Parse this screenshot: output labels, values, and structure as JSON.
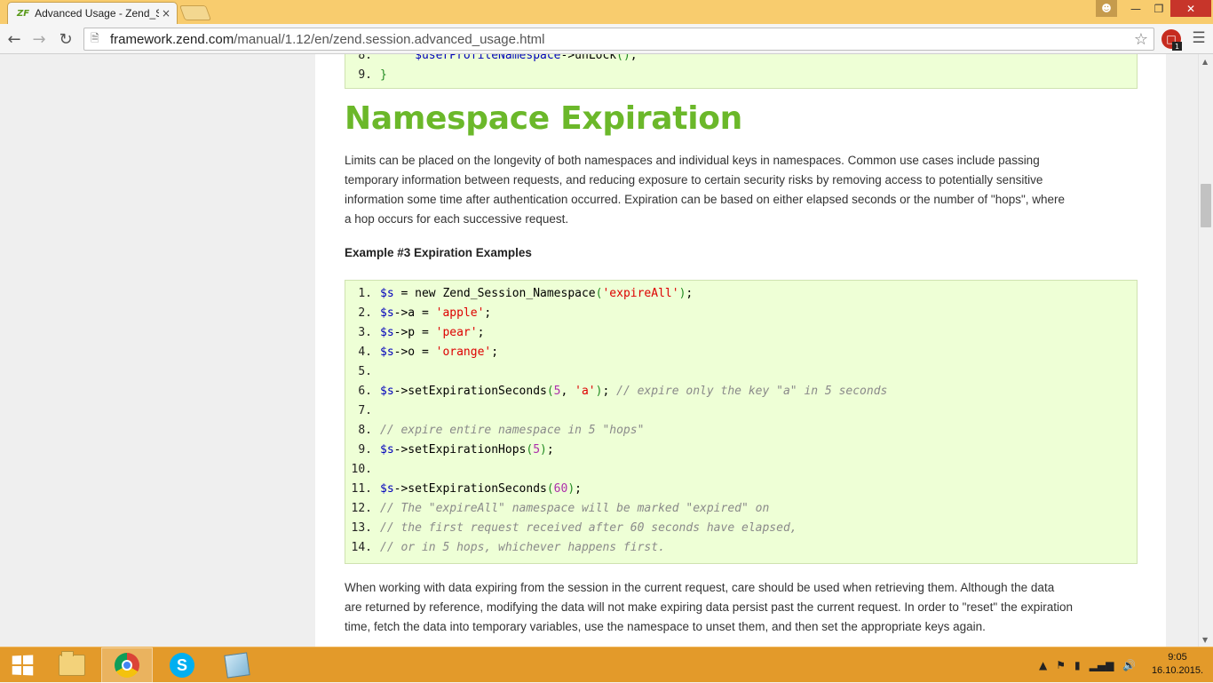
{
  "browser": {
    "tab_title": "Advanced Usage - Zend_S",
    "tab_logo": "ZF",
    "tab_close": "×",
    "url_host": "framework.zend.com",
    "url_path": "/manual/1.12/en/zend.session.advanced_usage.html",
    "ext_badge": "1",
    "colors": {
      "titlebar": "#f8cc6e",
      "close": "#c7352a"
    }
  },
  "page": {
    "top_code": [
      {
        "num": "8.",
        "parts": [
          {
            "cls": "d",
            "text": "     "
          },
          {
            "cls": "v",
            "text": "$userProfileNamespace"
          },
          {
            "cls": "d",
            "text": "->unLock"
          },
          {
            "cls": "p",
            "text": "()"
          },
          {
            "cls": "d",
            "text": ";"
          }
        ]
      },
      {
        "num": "9.",
        "parts": [
          {
            "cls": "p",
            "text": "}"
          }
        ]
      }
    ],
    "heading": "Namespace Expiration",
    "intro_lines": [
      "Limits can be placed on the longevity of both namespaces and individual keys in namespaces. Common use cases include passing",
      "temporary information between requests, and reducing exposure to certain security risks by removing access to potentially sensitive",
      "information some time after authentication occurred. Expiration can be based on either elapsed seconds or the number of \"hops\", where",
      "a hop occurs for each successive request."
    ],
    "example_title": "Example #3 Expiration Examples",
    "code": [
      {
        "num": "1.",
        "parts": [
          {
            "cls": "v",
            "text": "$s"
          },
          {
            "cls": "d",
            "text": " = "
          },
          {
            "cls": "k",
            "text": "new"
          },
          {
            "cls": "d",
            "text": " Zend_Session_Namespace"
          },
          {
            "cls": "p",
            "text": "("
          },
          {
            "cls": "s",
            "text": "'expireAll'"
          },
          {
            "cls": "p",
            "text": ")"
          },
          {
            "cls": "d",
            "text": ";"
          }
        ]
      },
      {
        "num": "2.",
        "parts": [
          {
            "cls": "v",
            "text": "$s"
          },
          {
            "cls": "d",
            "text": "->a = "
          },
          {
            "cls": "s",
            "text": "'apple'"
          },
          {
            "cls": "d",
            "text": ";"
          }
        ]
      },
      {
        "num": "3.",
        "parts": [
          {
            "cls": "v",
            "text": "$s"
          },
          {
            "cls": "d",
            "text": "->p = "
          },
          {
            "cls": "s",
            "text": "'pear'"
          },
          {
            "cls": "d",
            "text": ";"
          }
        ]
      },
      {
        "num": "4.",
        "parts": [
          {
            "cls": "v",
            "text": "$s"
          },
          {
            "cls": "d",
            "text": "->o = "
          },
          {
            "cls": "s",
            "text": "'orange'"
          },
          {
            "cls": "d",
            "text": ";"
          }
        ]
      },
      {
        "num": "5.",
        "parts": []
      },
      {
        "num": "6.",
        "parts": [
          {
            "cls": "v",
            "text": "$s"
          },
          {
            "cls": "d",
            "text": "->setExpirationSeconds"
          },
          {
            "cls": "p",
            "text": "("
          },
          {
            "cls": "n",
            "text": "5"
          },
          {
            "cls": "d",
            "text": ", "
          },
          {
            "cls": "s",
            "text": "'a'"
          },
          {
            "cls": "p",
            "text": ")"
          },
          {
            "cls": "d",
            "text": "; "
          },
          {
            "cls": "c",
            "text": "// expire only the key \"a\" in 5 seconds"
          }
        ]
      },
      {
        "num": "7.",
        "parts": []
      },
      {
        "num": "8.",
        "parts": [
          {
            "cls": "c",
            "text": "// expire entire namespace in 5 \"hops\""
          }
        ]
      },
      {
        "num": "9.",
        "parts": [
          {
            "cls": "v",
            "text": "$s"
          },
          {
            "cls": "d",
            "text": "->setExpirationHops"
          },
          {
            "cls": "p",
            "text": "("
          },
          {
            "cls": "n",
            "text": "5"
          },
          {
            "cls": "p",
            "text": ")"
          },
          {
            "cls": "d",
            "text": ";"
          }
        ]
      },
      {
        "num": "10.",
        "parts": []
      },
      {
        "num": "11.",
        "parts": [
          {
            "cls": "v",
            "text": "$s"
          },
          {
            "cls": "d",
            "text": "->setExpirationSeconds"
          },
          {
            "cls": "p",
            "text": "("
          },
          {
            "cls": "n",
            "text": "60"
          },
          {
            "cls": "p",
            "text": ")"
          },
          {
            "cls": "d",
            "text": ";"
          }
        ]
      },
      {
        "num": "12.",
        "parts": [
          {
            "cls": "c",
            "text": "// The \"expireAll\" namespace will be marked \"expired\" on"
          }
        ]
      },
      {
        "num": "13.",
        "parts": [
          {
            "cls": "c",
            "text": "// the first request received after 60 seconds have elapsed,"
          }
        ]
      },
      {
        "num": "14.",
        "parts": [
          {
            "cls": "c",
            "text": "// or in 5 hops, whichever happens first."
          }
        ]
      }
    ],
    "outro_lines": [
      "When working with data expiring from the session in the current request, care should be used when retrieving them. Although the data",
      "are returned by reference, modifying the data will not make expiring data persist past the current request. In order to \"reset\" the expiration",
      "time, fetch the data into temporary variables, use the namespace to unset them, and then set the appropriate keys again."
    ],
    "colors": {
      "heading": "#6bb82a",
      "code_bg": "#eeffd6"
    }
  },
  "taskbar": {
    "items": [
      "file-explorer-icon",
      "chrome-icon",
      "skype-icon",
      "notepad-icon"
    ],
    "skype_letter": "S",
    "clock_time": "9:05",
    "clock_date": "16.10.2015.",
    "colors": {
      "background": "#e39a2a"
    }
  }
}
